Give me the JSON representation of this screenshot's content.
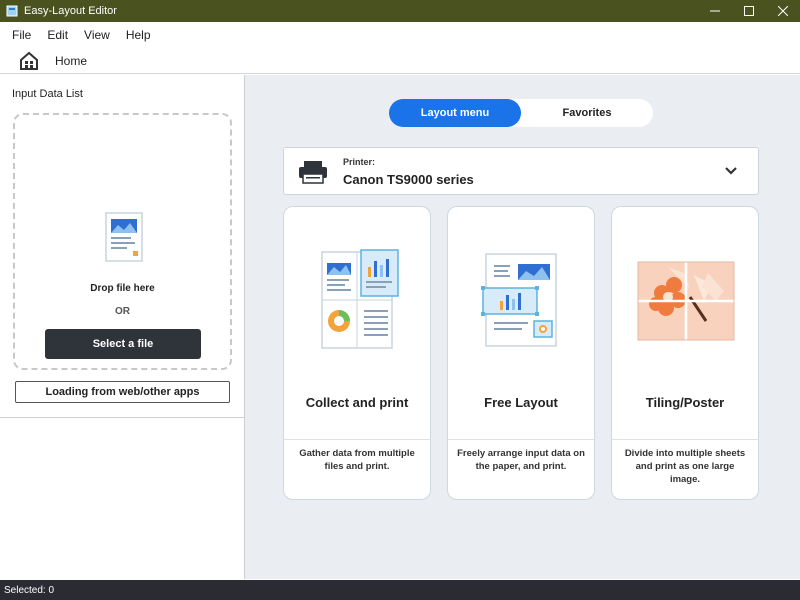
{
  "window": {
    "title": "Easy-Layout Editor"
  },
  "menu": {
    "items": [
      "File",
      "Edit",
      "View",
      "Help"
    ]
  },
  "home": {
    "label": "Home"
  },
  "left_panel": {
    "title": "Input Data List",
    "drop_text": "Drop file here",
    "or_text": "OR",
    "select_button": "Select a file",
    "load_button": "Loading from web/other apps"
  },
  "toggle": {
    "layout_menu": "Layout menu",
    "favorites": "Favorites"
  },
  "printer": {
    "label": "Printer:",
    "name": "Canon TS9000 series"
  },
  "cards": [
    {
      "title": "Collect and print",
      "desc": "Gather data from multiple files and print."
    },
    {
      "title": "Free Layout",
      "desc": "Freely arrange input data on the paper, and print."
    },
    {
      "title": "Tiling/Poster",
      "desc": "Divide into multiple sheets and print as one large image."
    }
  ],
  "status": {
    "text": "Selected: 0"
  },
  "colors": {
    "accent": "#1a73e8",
    "titlebar": "#4a5220",
    "statusbar": "#2b2b33",
    "select_button": "#2f343a"
  }
}
